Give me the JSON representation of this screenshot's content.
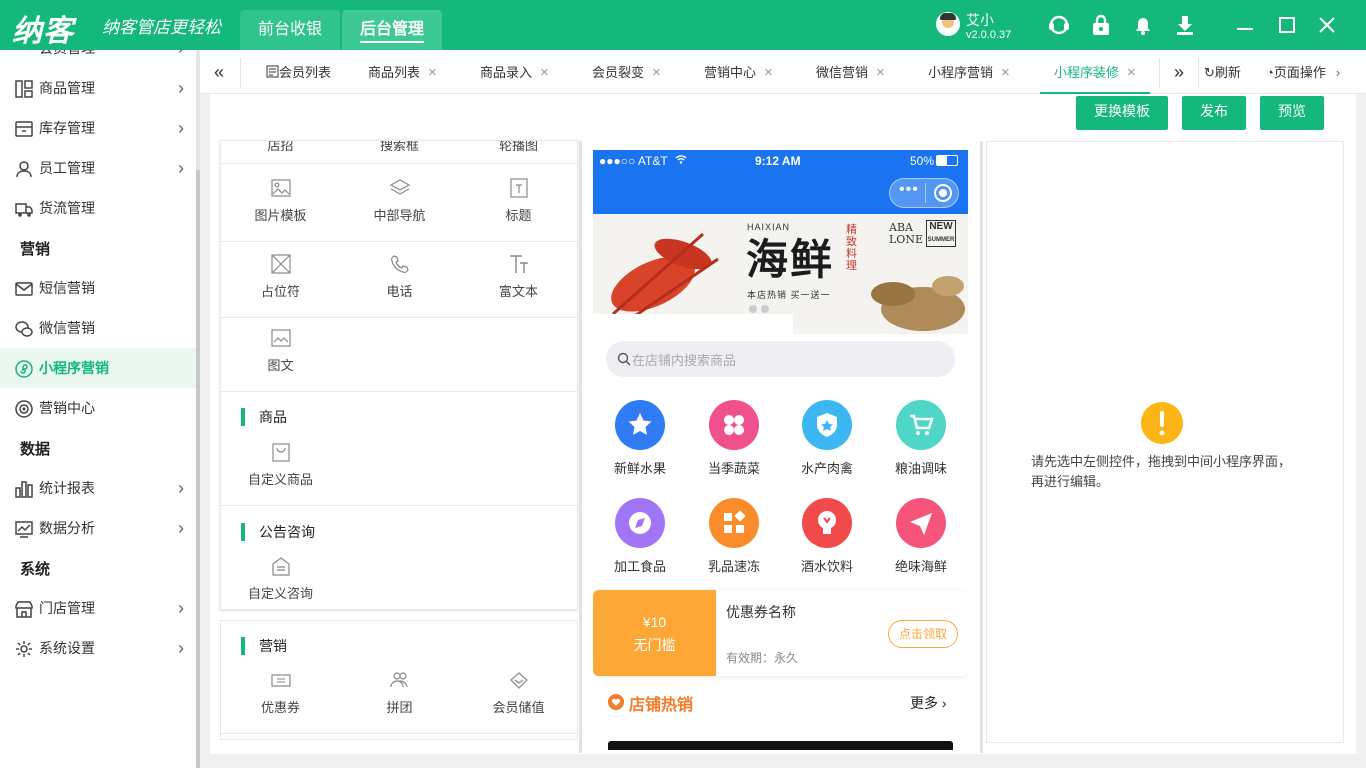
{
  "app": {
    "logo": "纳客",
    "slogan": "纳客管店更轻松"
  },
  "top_tabs": [
    "前台收银",
    "后台管理"
  ],
  "user": {
    "name": "艾小",
    "version": "v2.0.0.37"
  },
  "sidebar": {
    "partial_top": "会员管理",
    "items": [
      {
        "label": "商品管理",
        "icon": "grid-icon",
        "arrow": "›"
      },
      {
        "label": "库存管理",
        "icon": "inventory-icon",
        "arrow": "›"
      },
      {
        "label": "员工管理",
        "icon": "person-icon",
        "arrow": "›"
      },
      {
        "label": "货流管理",
        "icon": "truck-icon",
        "arrow": ""
      }
    ],
    "group_marketing": "营销",
    "marketing_items": [
      {
        "label": "短信营销",
        "icon": "mail-icon",
        "arrow": ""
      },
      {
        "label": "微信营销",
        "icon": "wechat-icon",
        "arrow": ""
      },
      {
        "label": "小程序营销",
        "icon": "miniprogram-icon",
        "arrow": ""
      },
      {
        "label": "营销中心",
        "icon": "target-icon",
        "arrow": ""
      }
    ],
    "group_data": "数据",
    "data_items": [
      {
        "label": "统计报表",
        "icon": "bar-chart-icon",
        "arrow": "›"
      },
      {
        "label": "数据分析",
        "icon": "line-chart-icon",
        "arrow": "›"
      }
    ],
    "group_system": "系统",
    "system_items": [
      {
        "label": "门店管理",
        "icon": "store-icon",
        "arrow": "›"
      },
      {
        "label": "系统设置",
        "icon": "gear-icon",
        "arrow": "›"
      }
    ]
  },
  "tabs": {
    "collapse": "«",
    "items": [
      "会员列表",
      "商品列表",
      "商品录入",
      "会员裂变",
      "营销中心",
      "微信营销",
      "小程序营销",
      "小程序装修"
    ],
    "close": "×",
    "expand": "»",
    "refresh": "刷新",
    "page_ops": "页面操作"
  },
  "actions": {
    "change_template": "更换模板",
    "publish": "发布",
    "preview": "预览"
  },
  "palette": {
    "partial_row": [
      "店招",
      "搜索框",
      "轮播图"
    ],
    "row1": [
      "图片模板",
      "中部导航",
      "标题"
    ],
    "row2": [
      "占位符",
      "电话",
      "富文本"
    ],
    "row3": [
      "图文"
    ],
    "section_goods": "商品",
    "goods_items": [
      "自定义商品"
    ],
    "section_notice": "公告咨询",
    "notice_items": [
      "自定义咨询"
    ],
    "section_marketing": "营销",
    "marketing_items": [
      "优惠券",
      "拼团",
      "会员储值"
    ]
  },
  "phone": {
    "carrier": "●●●○○ AT&T",
    "time": "9:12 AM",
    "battery": "50%",
    "banner_title": "海鲜",
    "banner_pinyin": "HAIXIAN",
    "banner_sub": "精致料理",
    "banner_tag1": "ABA",
    "banner_tag2": "LONE",
    "banner_new": "NEW",
    "banner_summer": "SUMMER",
    "banner_promo": "本店热销 买一送一",
    "search_placeholder": "在店铺内搜索商品",
    "categories": [
      "新鲜水果",
      "当季蔬菜",
      "水产肉禽",
      "粮油调味",
      "加工食品",
      "乳品速冻",
      "酒水饮料",
      "绝味海鲜"
    ],
    "category_colors": [
      "#2f7cf6",
      "#f0508c",
      "#3cb7f2",
      "#4fd6c6",
      "#a176f5",
      "#fb8c2c",
      "#f14a4a",
      "#f5557a"
    ],
    "coupon": {
      "amount": "¥10",
      "condition": "无门槛",
      "name": "优惠券名称",
      "validity": "有效期：永久",
      "claim": "点击领取"
    },
    "hot": {
      "title": "店铺热销",
      "more": "更多"
    }
  },
  "props_panel": {
    "hint": "请先选中左侧控件，拖拽到中间小程序界面，再进行编辑。"
  }
}
